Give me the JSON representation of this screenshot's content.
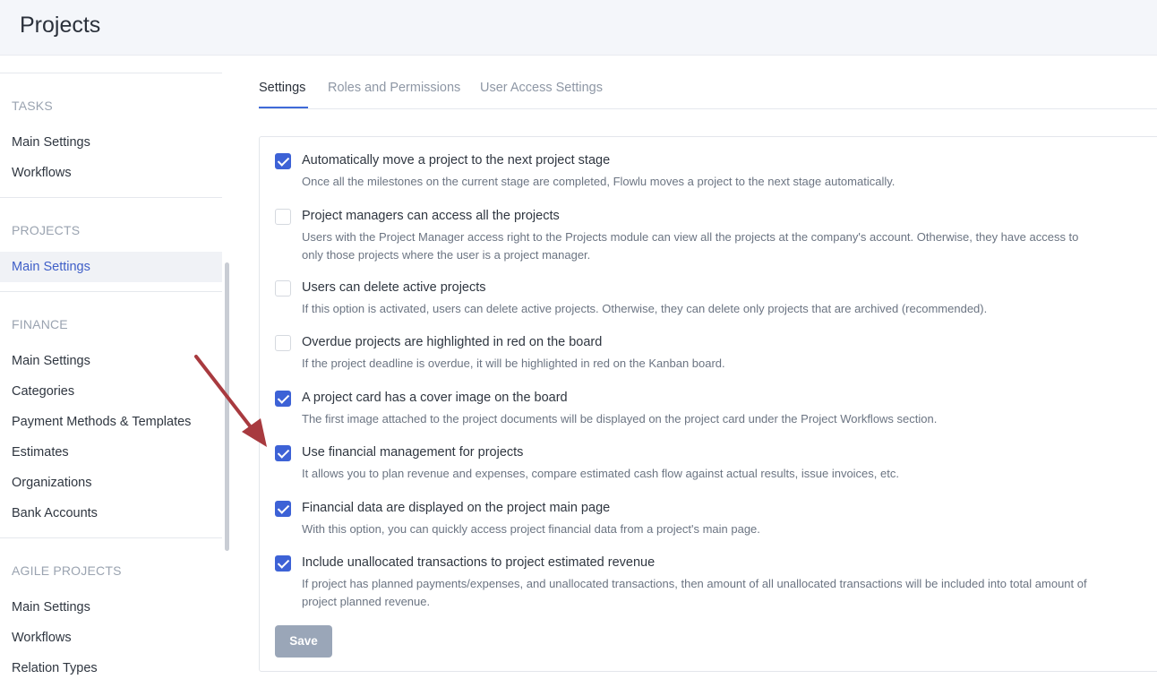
{
  "header": {
    "title": "Projects"
  },
  "sidebar": {
    "sections": [
      {
        "heading": "TASKS",
        "items": [
          {
            "label": "Main Settings"
          },
          {
            "label": "Workflows"
          }
        ]
      },
      {
        "heading": "PROJECTS",
        "items": [
          {
            "label": "Main Settings",
            "active": true
          }
        ]
      },
      {
        "heading": "FINANCE",
        "items": [
          {
            "label": "Main Settings"
          },
          {
            "label": "Categories"
          },
          {
            "label": "Payment Methods & Templates"
          },
          {
            "label": "Estimates"
          },
          {
            "label": "Organizations"
          },
          {
            "label": "Bank Accounts"
          }
        ]
      },
      {
        "heading": "AGILE PROJECTS",
        "items": [
          {
            "label": "Main Settings"
          },
          {
            "label": "Workflows"
          },
          {
            "label": "Relation Types"
          }
        ]
      }
    ]
  },
  "tabs": [
    {
      "label": "Settings",
      "active": true
    },
    {
      "label": "Roles and Permissions"
    },
    {
      "label": "User Access Settings"
    }
  ],
  "options": [
    {
      "title": "Automatically move a project to the next project stage",
      "desc": "Once all the milestones on the current stage are completed, Flowlu moves a project to the next stage automatically.",
      "checked": true
    },
    {
      "title": "Project managers can access all the projects",
      "desc": "Users with the Project Manager access right to the Projects module can view all the projects at the company's account. Otherwise, they have access to only those projects where the user is a project manager.",
      "checked": false
    },
    {
      "title": "Users can delete active projects",
      "desc": "If this option is activated, users can delete active projects. Otherwise, they can delete only projects that are archived (recommended).",
      "checked": false
    },
    {
      "title": "Overdue projects are highlighted in red on the board",
      "desc": "If the project deadline is overdue, it will be highlighted in red on the Kanban board.",
      "checked": false
    },
    {
      "title": "A project card has a cover image on the board",
      "desc": "The first image attached to the project documents will be displayed on the project card under the Project Workflows section.",
      "checked": true
    },
    {
      "title": "Use financial management for projects",
      "desc": "It allows you to plan revenue and expenses, compare estimated cash flow against actual results, issue invoices, etc.",
      "checked": true
    },
    {
      "title": "Financial data are displayed on the project main page",
      "desc": "With this option, you can quickly access project financial data from a project's main page.",
      "checked": true
    },
    {
      "title": "Include unallocated transactions to project estimated revenue",
      "desc": "If project has planned payments/expenses, and unallocated transactions, then amount of all unallocated transactions will be included into total amount of project planned revenue.",
      "checked": true
    }
  ],
  "save_label": "Save",
  "colors": {
    "accent": "#3d62d6",
    "annotation_arrow": "#a83a3f",
    "save_button": "#9aa6b8"
  }
}
